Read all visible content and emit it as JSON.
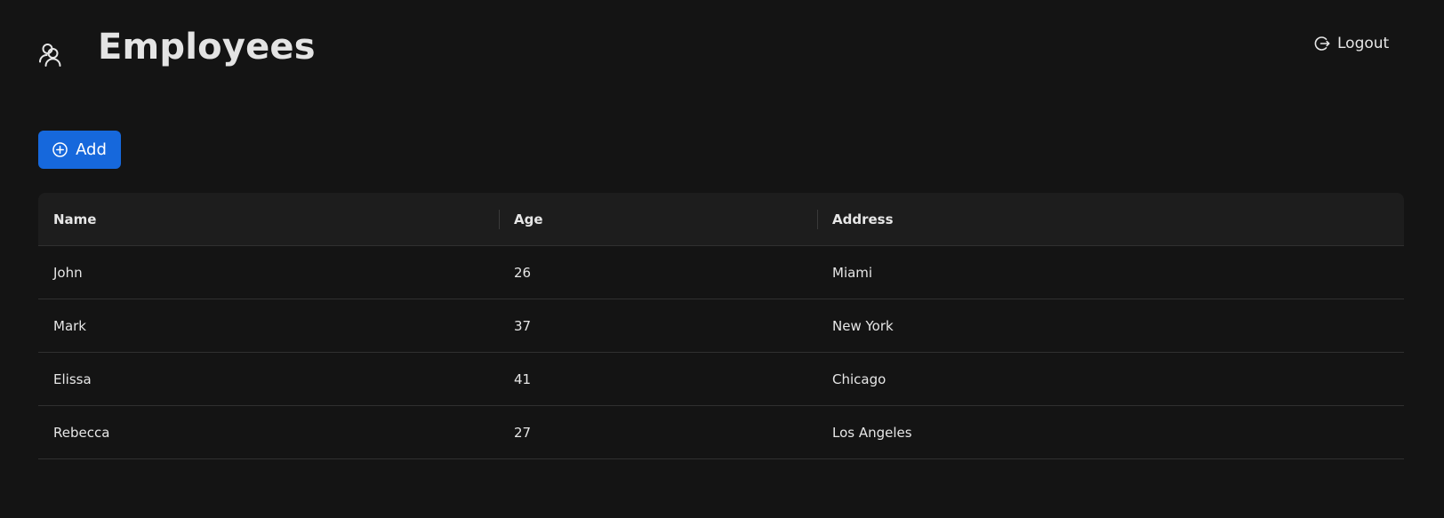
{
  "header": {
    "title": "Employees",
    "app_icon": "users-icon",
    "logout_label": "Logout",
    "logout_icon": "logout-icon"
  },
  "toolbar": {
    "add_label": "Add",
    "add_icon": "plus-circle-icon"
  },
  "table": {
    "columns": [
      "Name",
      "Age",
      "Address"
    ],
    "rows": [
      {
        "name": "John",
        "age": "26",
        "address": "Miami"
      },
      {
        "name": "Mark",
        "age": "37",
        "address": "New York"
      },
      {
        "name": "Elissa",
        "age": "41",
        "address": "Chicago"
      },
      {
        "name": "Rebecca",
        "age": "27",
        "address": "Los Angeles"
      }
    ]
  },
  "colors": {
    "background": "#141414",
    "header_row": "#1d1d1d",
    "primary": "#1668dc",
    "text": "#e6e6e6",
    "divider": "#303030"
  }
}
